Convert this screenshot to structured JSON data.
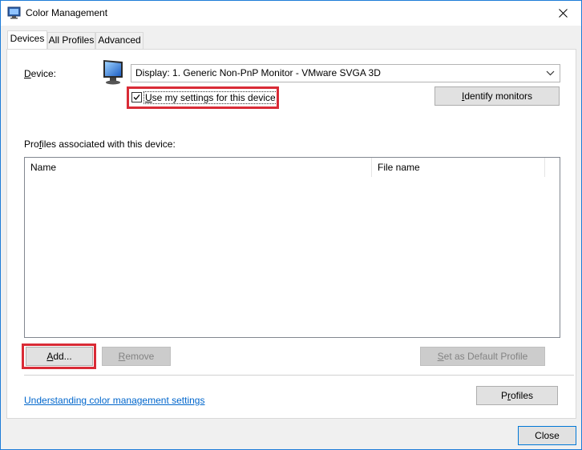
{
  "window": {
    "title": "Color Management"
  },
  "tabs": [
    {
      "label": "Devices",
      "active": true
    },
    {
      "label": "All Profiles",
      "active": false
    },
    {
      "label": "Advanced",
      "active": false
    }
  ],
  "device": {
    "label_mnemonic": "D",
    "label_rest": "evice:",
    "selected": "Display: 1. Generic Non-PnP Monitor - VMware SVGA 3D"
  },
  "use_settings": {
    "checked": true,
    "label_mnemonic": "U",
    "label_rest": "se my settings for this device"
  },
  "identify_button": {
    "mnemonic": "I",
    "rest": "dentify monitors"
  },
  "profiles_section": {
    "label_pre": "Pro",
    "label_mnemonic": "f",
    "label_rest": "iles associated with this device:",
    "columns": [
      "Name",
      "File name"
    ],
    "rows": []
  },
  "buttons": {
    "add_mnemonic": "A",
    "add_rest": "dd...",
    "remove_mnemonic": "R",
    "remove_rest": "emove",
    "set_default_mnemonic": "S",
    "set_default_rest": "et as Default Profile",
    "profiles_pre": "P",
    "profiles_mnemonic": "r",
    "profiles_rest": "ofiles",
    "close": "Close"
  },
  "link": {
    "text": "Understanding color management settings"
  },
  "colors": {
    "highlight": "#d92b36",
    "link": "#0066cc",
    "accent_border": "#1e7cd8"
  }
}
